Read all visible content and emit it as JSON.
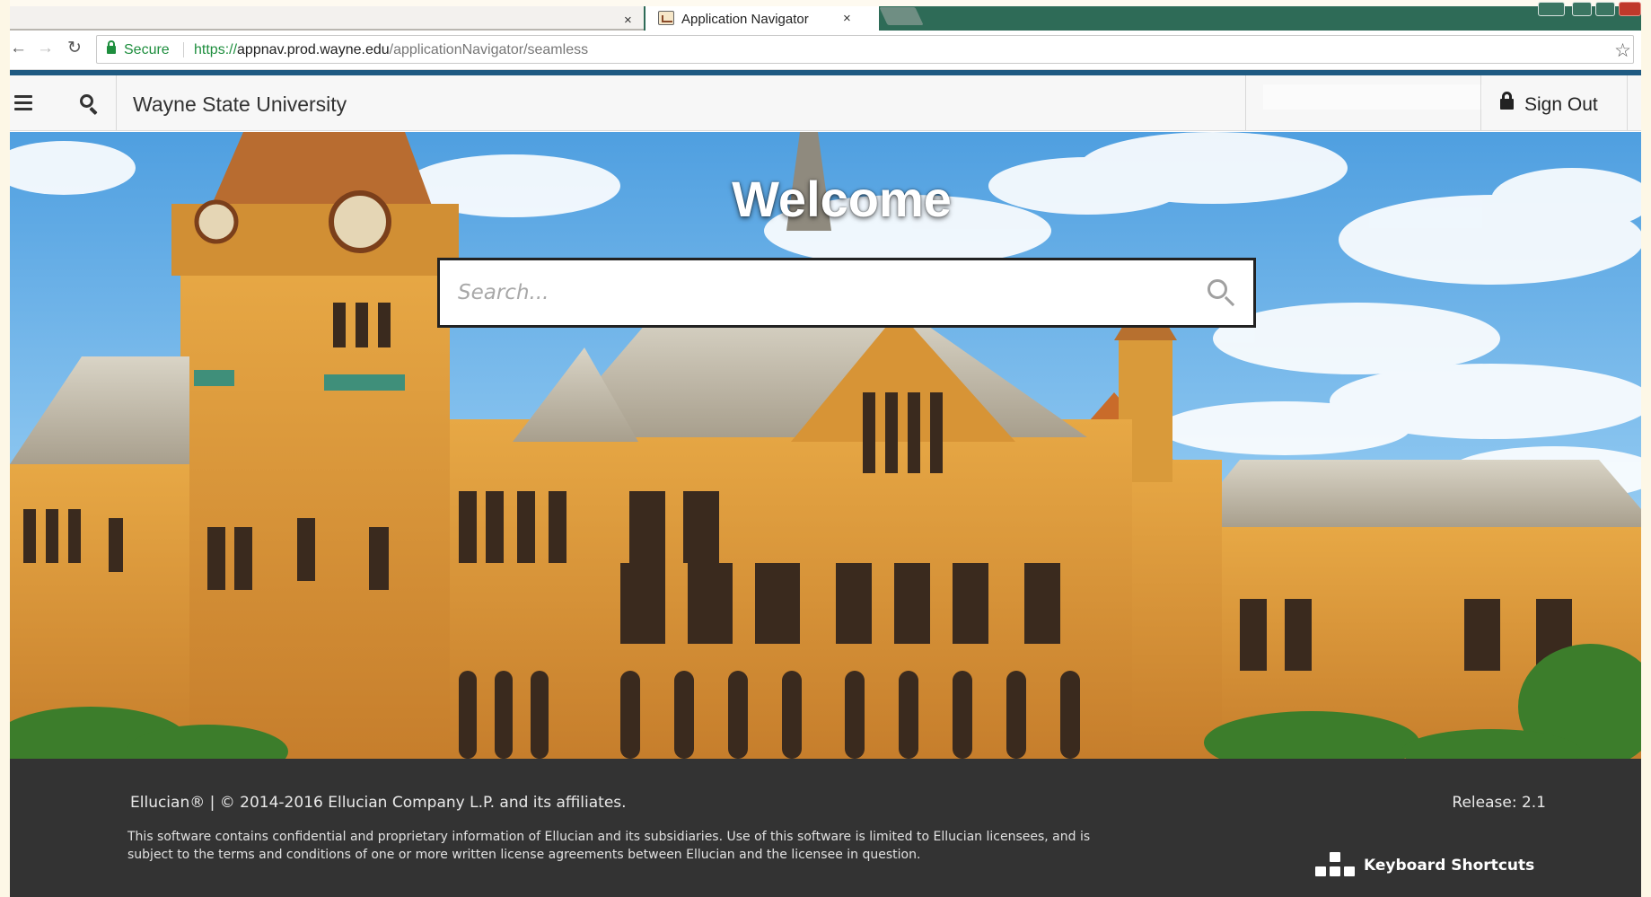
{
  "browser": {
    "tab_title": "Application Navigator",
    "tab_close": "×",
    "prev_tab_close": "×",
    "secure_label": "Secure",
    "url": {
      "scheme": "https://",
      "host": "appnav.prod.wayne.edu",
      "path": "/applicationNavigator/seamless"
    },
    "back_glyph": "←",
    "forward_glyph": "→",
    "reload_glyph": "↻",
    "bookmark_glyph": "☆"
  },
  "header": {
    "institution": "Wayne State University",
    "sign_out_label": "Sign Out"
  },
  "hero": {
    "welcome": "Welcome",
    "search_placeholder": "Search..."
  },
  "footer": {
    "copyright": "Ellucian® | © 2014-2016 Ellucian Company L.P. and its affiliates.",
    "legal": "This software contains confidential and proprietary information of Ellucian and its subsidiaries. Use of this software is limited to Ellucian licensees, and is subject to the terms and conditions of one or more written license agreements between Ellucian and the licensee in question.",
    "release": "Release: 2.1",
    "keyboard_shortcuts": "Keyboard Shortcuts"
  },
  "colors": {
    "accent_line": "#1e5a82",
    "footer_bg": "#333333",
    "tabstrip_dark": "#2e6b57",
    "secure_green": "#1e8e3e"
  },
  "icons": [
    "hamburger-menu-icon",
    "search-icon",
    "lock-icon",
    "star-icon",
    "keyboard-shortcuts-icon"
  ]
}
